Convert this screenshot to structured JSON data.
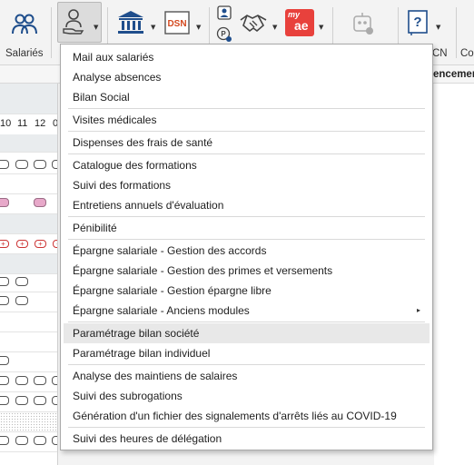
{
  "ribbon": {
    "salaries_label": "Salariés",
    "partial_label_cn": "CN",
    "partial_label_co": "Co",
    "dsn_text": "DSN",
    "my_text": "my",
    "ae_text": "ae"
  },
  "grid": {
    "columns": [
      "10",
      "11",
      "12",
      "0"
    ]
  },
  "header": {
    "partial_title": "encement"
  },
  "menu": {
    "items": [
      "Mail aux salariés",
      "Analyse absences",
      "Bilan Social",
      "Visites médicales",
      "Dispenses des frais de santé",
      "Catalogue des formations",
      "Suivi des formations",
      "Entretiens annuels d'évaluation",
      "Pénibilité",
      "Épargne salariale - Gestion des accords",
      "Épargne salariale - Gestion des primes et versements",
      "Épargne salariale - Gestion épargne libre",
      "Épargne salariale - Anciens modules",
      "Paramétrage bilan société",
      "Paramétrage bilan individuel",
      "Analyse des maintiens de salaires",
      "Suivi des subrogations",
      "Génération d'un fichier des signalements d'arrêts liés au COVID-19",
      "Suivi des heures de délégation"
    ],
    "highlighted": "Paramétrage bilan société",
    "submenu_arrow": "▸"
  },
  "colors": {
    "accent_blue": "#1f4e8c",
    "myae_red": "#e8413c",
    "menu_highlight": "#e8e8e8",
    "pill_pink": "#e7a8c9"
  }
}
